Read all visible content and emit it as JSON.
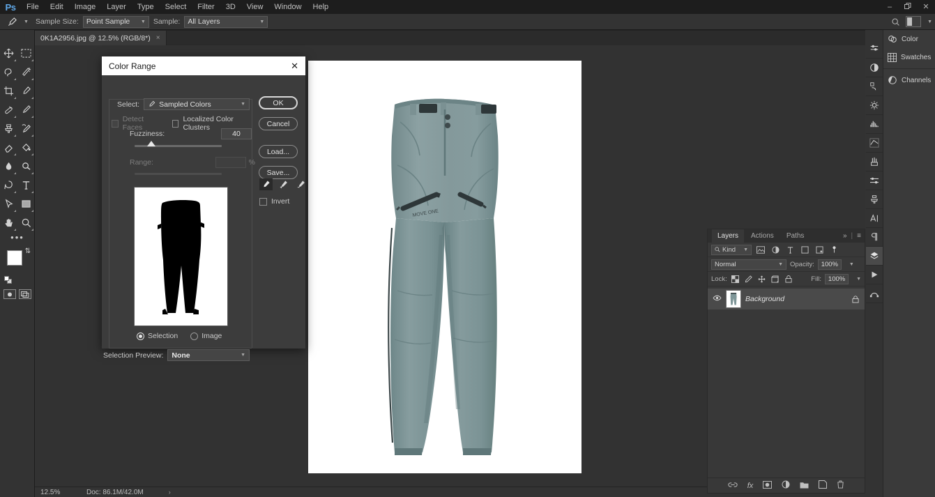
{
  "app": {
    "logo": "Ps",
    "menus": [
      "File",
      "Edit",
      "Image",
      "Layer",
      "Type",
      "Select",
      "Filter",
      "3D",
      "View",
      "Window",
      "Help"
    ],
    "window_controls": {
      "minimize": "–",
      "restore": "❐",
      "close": "✕"
    }
  },
  "options_bar": {
    "tool_icon": "eyedropper-icon",
    "sample_size_label": "Sample Size:",
    "sample_size_value": "Point Sample",
    "sample_label": "Sample:",
    "sample_value": "All Layers",
    "search_icon": "search-icon",
    "workspace_icon": "workspace-icon"
  },
  "document_tab": {
    "title": "0K1A2956.jpg @ 12.5% (RGB/8*)",
    "close": "×"
  },
  "toolbar": {
    "tools": [
      "move-tool",
      "marquee-tool",
      "lasso-tool",
      "magic-wand-tool",
      "crop-tool",
      "eyedropper-tool",
      "healing-brush-tool",
      "brush-tool",
      "clone-stamp-tool",
      "history-brush-tool",
      "eraser-tool",
      "gradient-tool",
      "blur-tool",
      "dodge-tool",
      "pen-tool",
      "type-tool",
      "path-selection-tool",
      "shape-tool",
      "hand-tool",
      "zoom-tool"
    ],
    "more_tools": "•••",
    "foreground_color": "#ffffff",
    "background_color": "#ffffff",
    "quick_mask_icon": "quick-mask-icon",
    "screen_mode_icon": "screen-mode-icon"
  },
  "dialog": {
    "title": "Color Range",
    "close_label": "✕",
    "select_label": "Select:",
    "select_value": "Sampled Colors",
    "detect_faces_label": "Detect Faces",
    "localized_clusters_label": "Localized Color Clusters",
    "fuzziness_label": "Fuzziness:",
    "fuzziness_value": "40",
    "range_label": "Range:",
    "range_value": "",
    "range_unit": "%",
    "preview_mode_selection": "Selection",
    "preview_mode_image": "Image",
    "selection_preview_label": "Selection Preview:",
    "selection_preview_value": "None",
    "buttons": {
      "ok": "OK",
      "cancel": "Cancel",
      "load": "Load...",
      "save": "Save..."
    },
    "eyedroppers": [
      "eyedropper-icon",
      "eyedropper-add-icon",
      "eyedropper-subtract-icon"
    ],
    "invert_label": "Invert"
  },
  "layers_panel": {
    "tabs": [
      "Layers",
      "Actions",
      "Paths"
    ],
    "active_tab": "Layers",
    "collapse_icon": "»",
    "menu_icon": "≡",
    "filter_label": "Kind",
    "filter_icons": [
      "pixel-filter-icon",
      "adjustment-filter-icon",
      "type-filter-icon",
      "shape-filter-icon",
      "smart-object-filter-icon"
    ],
    "toggle_icon": "filter-toggle-icon",
    "blend_mode": "Normal",
    "opacity_label": "Opacity:",
    "opacity_value": "100%",
    "lock_label": "Lock:",
    "lock_icons": [
      "lock-transparency-icon",
      "lock-image-icon",
      "lock-position-icon",
      "lock-artboard-icon",
      "lock-all-icon"
    ],
    "fill_label": "Fill:",
    "fill_value": "100%",
    "layers": [
      {
        "name": "Background",
        "visible": true,
        "locked": true,
        "thumbnail": "pants-thumbnail"
      }
    ],
    "footer_icons": [
      "link-layers-icon",
      "layer-style-icon",
      "layer-mask-icon",
      "adjustment-layer-icon",
      "new-group-icon",
      "new-layer-icon",
      "delete-layer-icon"
    ]
  },
  "right_rail": {
    "icons": [
      "adjustments-icon",
      "styles-icon",
      "actions-history-icon",
      "navigator-icon",
      "histogram-icon",
      "info-icon",
      "brushes-icon",
      "brush-settings-icon",
      "clone-source-icon",
      "character-icon",
      "paragraph-icon",
      "layers-icon",
      "timeline-icon",
      "paths-icon"
    ],
    "active": "layers-icon"
  },
  "dock_panels": [
    {
      "label": "Color",
      "icon": "color-icon"
    },
    {
      "label": "Swatches",
      "icon": "swatches-icon"
    },
    {
      "label": "Channels",
      "icon": "channels-icon"
    }
  ],
  "status_bar": {
    "zoom": "12.5%",
    "doc_info": "Doc: 86.1M/42.0M",
    "arrow": "›"
  },
  "canvas": {
    "image_name": "pants-photo",
    "fabric_color": "#7e9698",
    "fabric_shadow": "#6b8486",
    "fabric_highlight": "#92a8a9",
    "trim_color": "#2e3739",
    "background_color": "#ffffff",
    "logo_text": "MOVE ONE"
  }
}
